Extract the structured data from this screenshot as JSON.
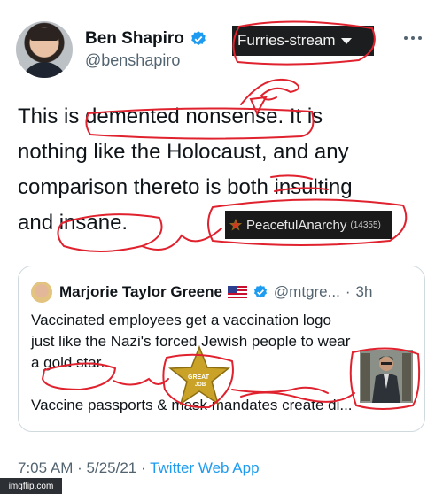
{
  "tweet": {
    "author": {
      "name": "Ben Shapiro",
      "handle": "@benshapiro"
    },
    "lines": [
      "This is demented nonsense. It is",
      "nothing like the Holocaust, and any",
      "comparison thereto is both insulting",
      "and insane."
    ],
    "meta": {
      "time": "7:05 AM",
      "sep": "·",
      "date": "5/25/21",
      "app": "Twitter Web App"
    }
  },
  "overlay": {
    "stream_selector": "Furries-stream",
    "user_tag": {
      "name": "PeacefulAnarchy",
      "count": "(14355)"
    },
    "star_text": [
      "GREAT",
      "JOB"
    ]
  },
  "quoted": {
    "name": "Marjorie Taylor Greene",
    "handle": "@mtgre...",
    "dot": "·",
    "time": "3h",
    "lines": [
      "Vaccinated employees get a vaccination logo",
      "just like the Nazi's forced Jewish people to wear",
      "a gold star."
    ],
    "line4": "Vaccine passports & mask mandates create di..."
  },
  "watermark": "imgflip.com",
  "colors": {
    "verified": "#1d9bf0",
    "scribble": "#e0222e",
    "stream_bg": "#1c1d1f",
    "link": "#1d9bf0"
  }
}
